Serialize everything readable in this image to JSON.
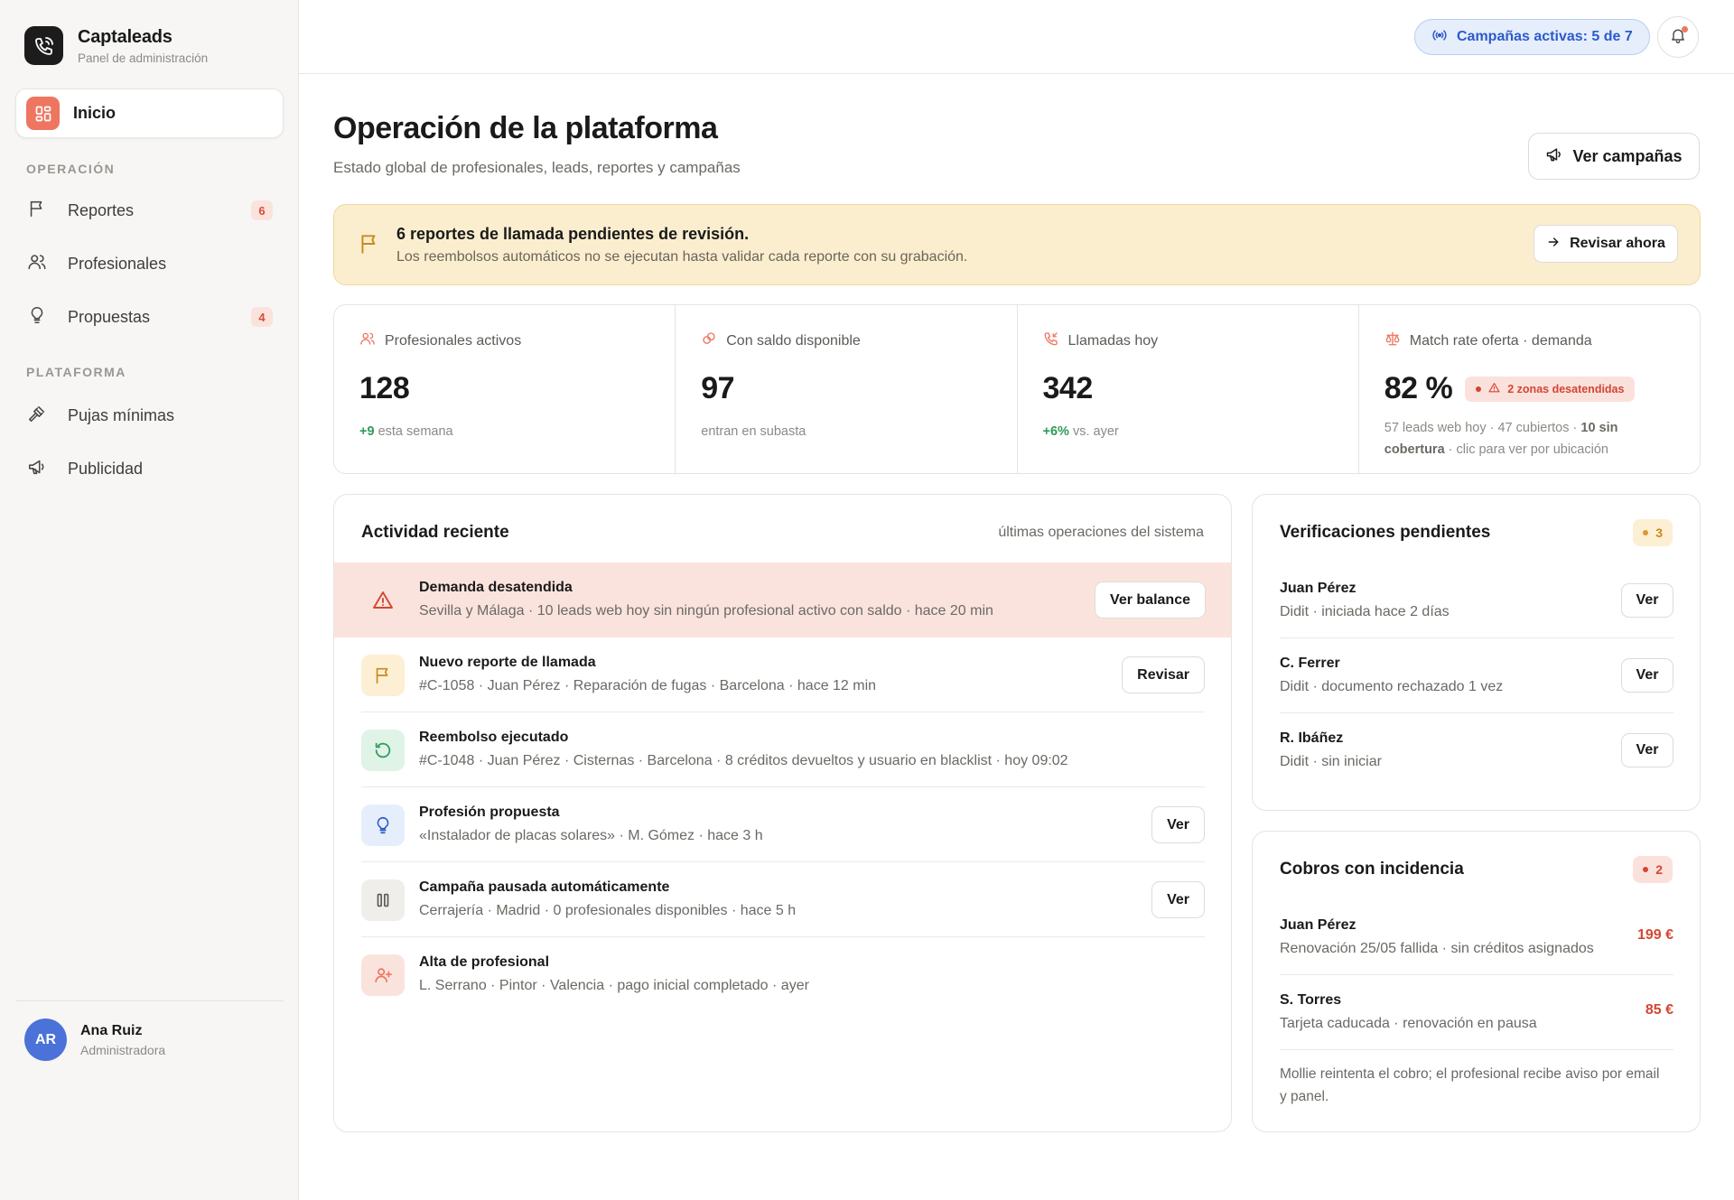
{
  "brand": {
    "name": "Captaleads",
    "subtitle": "Panel de administración"
  },
  "sidebar": {
    "active": {
      "label": "Inicio",
      "icon": "dashboard-icon"
    },
    "sections": [
      {
        "title": "OPERACIÓN",
        "items": [
          {
            "label": "Reportes",
            "icon": "flag-icon",
            "badge": "6"
          },
          {
            "label": "Profesionales",
            "icon": "users-icon",
            "badge": ""
          },
          {
            "label": "Propuestas",
            "icon": "lightbulb-icon",
            "badge": "4"
          }
        ]
      },
      {
        "title": "PLATAFORMA",
        "items": [
          {
            "label": "Pujas mínimas",
            "icon": "gavel-icon",
            "badge": ""
          },
          {
            "label": "Publicidad",
            "icon": "megaphone-icon",
            "badge": ""
          }
        ]
      }
    ],
    "user": {
      "initials": "AR",
      "name": "Ana Ruiz",
      "role": "Administradora"
    }
  },
  "topbar": {
    "campaigns_pill": "Campañas activas: 5 de 7"
  },
  "header": {
    "title": "Operación de la plataforma",
    "subtitle": "Estado global de profesionales, leads, reportes y campañas",
    "campaigns_button": "Ver campañas"
  },
  "alert": {
    "title": "6 reportes de llamada pendientes de revisión.",
    "text": "Los reembolsos automáticos no se ejecutan hasta validar cada reporte con su grabación.",
    "button": "Revisar ahora"
  },
  "stats": [
    {
      "label": "Profesionales activos",
      "value": "128",
      "delta": "+9",
      "foot": "esta semana"
    },
    {
      "label": "Con saldo disponible",
      "value": "97",
      "foot": "entran en subasta"
    },
    {
      "label": "Llamadas hoy",
      "value": "342",
      "delta": "+6%",
      "foot": "vs. ayer"
    },
    {
      "label": "Match rate oferta · demanda",
      "value": "82 %",
      "badge": "2 zonas desatendidas",
      "foot_a": "57 leads web hoy · 47 cubiertos · ",
      "foot_strong": "10 sin cobertura",
      "foot_b": " · clic para ver por ubicación"
    }
  ],
  "activity": {
    "title": "Actividad reciente",
    "meta": "últimas operaciones del sistema",
    "items": [
      {
        "title": "Demanda desatendida",
        "desc": "Sevilla y Málaga · 10 leads web hoy sin ningún profesional activo con saldo · hace 20 min",
        "button": "Ver balance",
        "icon": "warning-icon"
      },
      {
        "title": "Nuevo reporte de llamada",
        "desc": "#C-1058 · Juan Pérez · Reparación de fugas · Barcelona · hace 12 min",
        "button": "Revisar",
        "icon": "flag-icon"
      },
      {
        "title": "Reembolso ejecutado",
        "desc": "#C-1048 · Juan Pérez · Cisternas · Barcelona · 8 créditos devueltos y usuario en blacklist · hoy 09:02",
        "button": "",
        "icon": "refund-icon"
      },
      {
        "title": "Profesión propuesta",
        "desc": "«Instalador de placas solares» · M. Gómez · hace 3 h",
        "button": "Ver",
        "icon": "lightbulb-icon"
      },
      {
        "title": "Campaña pausada automáticamente",
        "desc": "Cerrajería · Madrid · 0 profesionales disponibles · hace 5 h",
        "button": "Ver",
        "icon": "pause-icon"
      },
      {
        "title": "Alta de profesional",
        "desc": "L. Serrano · Pintor · Valencia · pago inicial completado · ayer",
        "button": "",
        "icon": "user-plus-icon"
      }
    ]
  },
  "verifications": {
    "title": "Verificaciones pendientes",
    "count": "3",
    "items": [
      {
        "name": "Juan Pérez",
        "desc": "Didit · iniciada hace 2 días",
        "button": "Ver"
      },
      {
        "name": "C. Ferrer",
        "desc": "Didit · documento rechazado 1 vez",
        "button": "Ver"
      },
      {
        "name": "R. Ibáñez",
        "desc": "Didit · sin iniciar",
        "button": "Ver"
      }
    ]
  },
  "payments": {
    "title": "Cobros con incidencia",
    "count": "2",
    "items": [
      {
        "name": "Juan Pérez",
        "desc": "Renovación 25/05 fallida · sin créditos asignados",
        "amount": "199 €"
      },
      {
        "name": "S. Torres",
        "desc": "Tarjeta caducada · renovación en pausa",
        "amount": "85 €"
      }
    ],
    "note": "Mollie reintenta el cobro; el profesional recibe aviso por email y panel."
  },
  "colors": {
    "accent": "#ee7660",
    "blue": "#2c5bc9",
    "danger": "#d44632",
    "success": "#2f9a5c",
    "warning_bg": "#fbeecf"
  }
}
